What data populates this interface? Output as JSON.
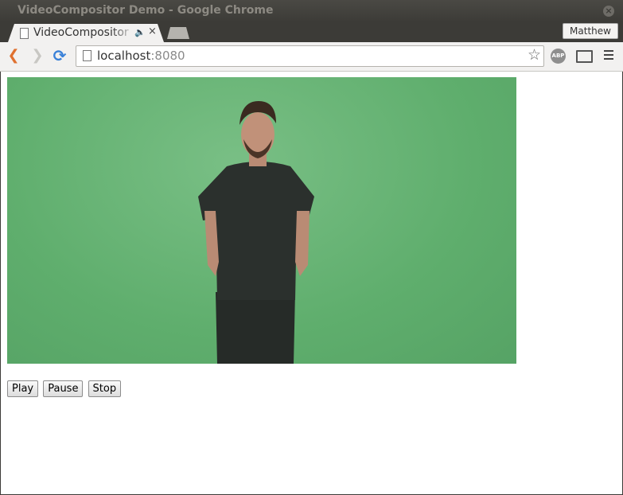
{
  "window": {
    "title": "VideoCompositor Demo - Google Chrome",
    "close_glyph": "×"
  },
  "tabs": {
    "active_title": "VideoCompositor Demo",
    "audio_glyph": "🔈",
    "close_glyph": "×"
  },
  "profile": {
    "name": "Matthew"
  },
  "toolbar": {
    "back_glyph": "❮",
    "forward_glyph": "❯",
    "reload_glyph": "⟳",
    "url_host": "localhost",
    "url_port": ":8080",
    "star_glyph": "☆",
    "abp_label": "ABP"
  },
  "controls": {
    "play_label": "Play",
    "pause_label": "Pause",
    "stop_label": "Stop"
  },
  "icons": {
    "page": "document-icon",
    "audio": "speaker-icon",
    "back": "back-arrow-icon",
    "forward": "forward-arrow-icon",
    "reload": "reload-icon",
    "star": "bookmark-star-icon",
    "abp": "adblock-icon",
    "cast": "cast-icon",
    "menu": "hamburger-menu-icon"
  },
  "colors": {
    "video_background": "#5fae6d",
    "back_arrow": "#e0712f",
    "reload": "#3a81d8"
  }
}
